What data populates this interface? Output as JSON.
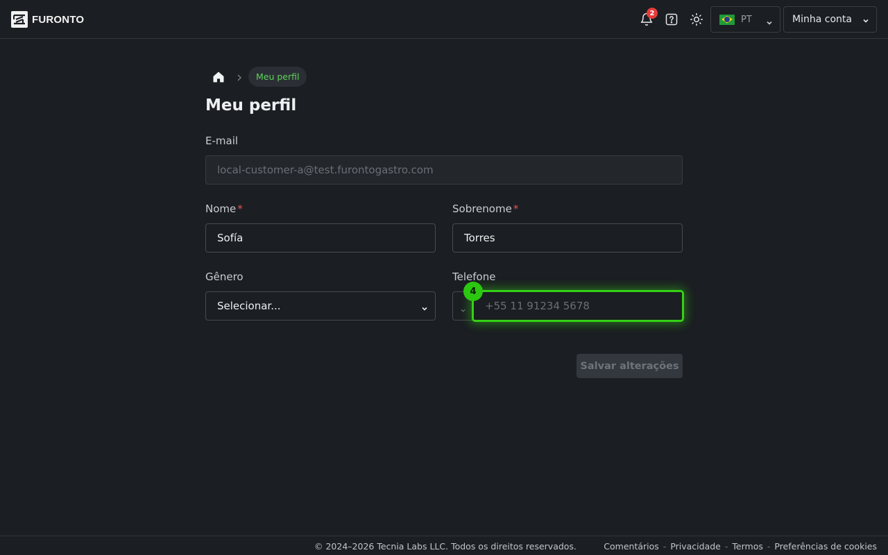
{
  "header": {
    "brand": "FURONTO",
    "notifications_count": "2",
    "language_code": "PT",
    "account_label": "Minha conta"
  },
  "breadcrumb": {
    "current": "Meu perfil"
  },
  "page": {
    "title": "Meu perfil"
  },
  "form": {
    "email": {
      "label": "E-mail",
      "value": "local-customer-a@test.furontogastro.com"
    },
    "first_name": {
      "label": "Nome",
      "required_mark": "*",
      "value": "Sofía"
    },
    "last_name": {
      "label": "Sobrenome",
      "required_mark": "*",
      "value": "Torres"
    },
    "gender": {
      "label": "Gênero",
      "selected": "Selecionar..."
    },
    "phone": {
      "label": "Telefone",
      "placeholder": "+55 11 91234 5678"
    },
    "save_label": "Salvar alterações"
  },
  "overlay": {
    "marker_number": "4",
    "highlight_color": "#35d016"
  },
  "footer": {
    "copyright": "© 2024–2026 Tecnia Labs LLC. Todos os direitos reservados.",
    "links": [
      "Comentários",
      "Privacidade",
      "Termos",
      "Preferências de cookies"
    ],
    "separator": "-"
  },
  "icons": [
    "brand-logo-icon",
    "bell-icon",
    "help-icon",
    "sun-icon",
    "brazil-flag-icon",
    "chevron-down-icon",
    "home-icon",
    "chevron-right-icon"
  ]
}
